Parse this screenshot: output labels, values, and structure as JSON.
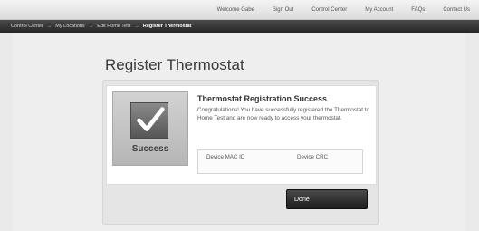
{
  "top_nav": {
    "links": [
      "Welcome Gabe",
      "Sign Out",
      "Control Center",
      "My Account",
      "FAQs",
      "Contact Us"
    ]
  },
  "breadcrumb": {
    "items": [
      "Control Center",
      "My Locations",
      "Edit Home Test",
      "Register Thermostat"
    ],
    "separator": "→"
  },
  "page": {
    "title": "Register Thermostat"
  },
  "status_tile": {
    "icon": "checkmark-icon",
    "label": "Success"
  },
  "message": {
    "title": "Thermostat Registration Success",
    "body": "Congratulations! You have successfully registered the Thermostat to Home Test and are now ready to access your thermostat."
  },
  "device": {
    "mac_label": "Device MAC ID",
    "crc_label": "Device CRC"
  },
  "actions": {
    "done_label": "Done"
  },
  "colors": {
    "breadcrumb_bar": "#262626",
    "button": "#1d1d1d",
    "page_background": "#eaeaea"
  }
}
